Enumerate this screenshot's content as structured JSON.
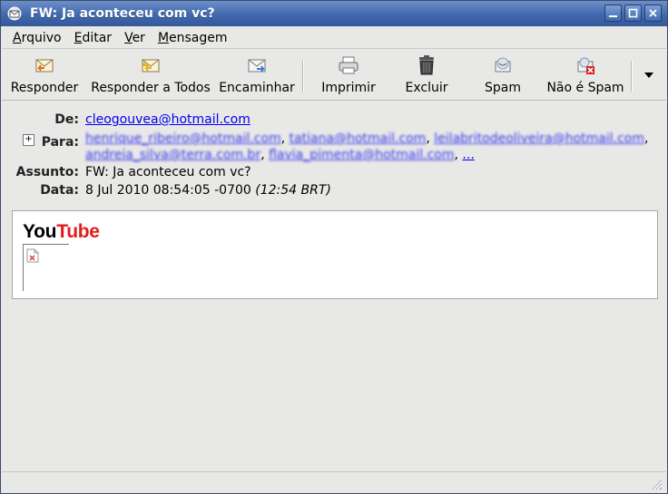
{
  "window": {
    "title": "FW: Ja aconteceu com vc?",
    "title_icon": "mail-envelope-icon"
  },
  "menu": {
    "items": [
      {
        "label": "Arquivo"
      },
      {
        "label": "Editar"
      },
      {
        "label": "Ver"
      },
      {
        "label": "Mensagem"
      }
    ]
  },
  "toolbar": {
    "reply": "Responder",
    "reply_all": "Responder a Todos",
    "forward": "Encaminhar",
    "print": "Imprimir",
    "delete": "Excluir",
    "spam": "Spam",
    "not_spam": "Não é Spam"
  },
  "header": {
    "from_label": "De:",
    "from": "cleogouvea@hotmail.com",
    "to_label": "Para:",
    "to_line1": [
      "henrique_ribeiro@hotmail.com",
      "tatiana@hotmail.com",
      "leilabritodeoliveira@hotmail.com"
    ],
    "to_line2": [
      "andreia_silva@terra.com.br",
      "flavia_pimenta@hotmail.com"
    ],
    "to_more": "...",
    "subject_label": "Assunto:",
    "subject": "FW: Ja aconteceu com vc?",
    "date_label": "Data:",
    "date": "8 Jul 2010 08:54:05 -0700",
    "date_local": "(12:54 BRT)"
  },
  "body": {
    "logo_you": "You",
    "logo_tube": "Tube"
  },
  "colors": {
    "titlebar": "#3f68ae",
    "link": "#0000ee",
    "youtube_red": "#e31b1b"
  }
}
